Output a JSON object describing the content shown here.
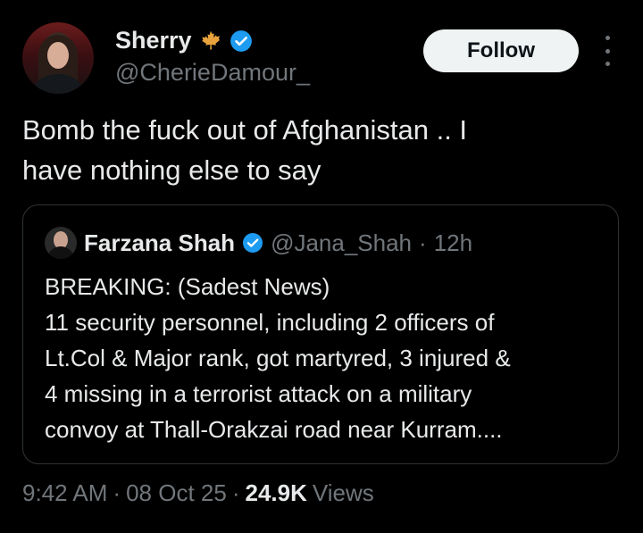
{
  "author": {
    "display_name": "Sherry",
    "handle": "@CherieDamour_"
  },
  "follow_button": {
    "label": "Follow"
  },
  "tweet": {
    "text_lines": [
      "Bomb the fuck out of Afghanistan .. I",
      "have nothing else to say"
    ]
  },
  "quote": {
    "display_name": "Farzana Shah",
    "handle": "@Jana_Shah",
    "separator": "·",
    "time": "12h",
    "body_lines": [
      "BREAKING:  (Sadest News)",
      "11 security personnel, including 2 officers of",
      "Lt.Col & Major rank, got martyred, 3 injured &",
      "4 missing in a terrorist attack on a military",
      "convoy at Thall-Orakzai road near Kurram...."
    ]
  },
  "footer": {
    "time": "9:42 AM",
    "sep1": "·",
    "date": "08 Oct 25",
    "sep2": "·",
    "views_count": "24.9K",
    "views_label": "Views"
  },
  "icons": {
    "verified": "verified-badge-icon",
    "maple_leaf": "maple-leaf-icon",
    "more": "more-options-icon"
  },
  "colors": {
    "background": "#000000",
    "text_primary": "#e7e9ea",
    "text_secondary": "#71767b",
    "verified_blue": "#1d9bf0",
    "maple_orange": "#e8a33c",
    "border": "#2f3336"
  }
}
